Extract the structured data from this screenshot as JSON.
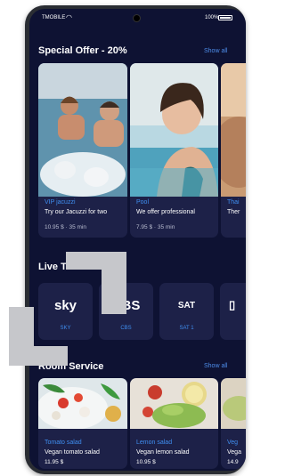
{
  "status": {
    "carrier": "TMOBILE",
    "battery": "100%"
  },
  "special_offer": {
    "title": "Special Offer - 20%",
    "show_all": "Show all",
    "cards": [
      {
        "title": "VIP jacuzzi",
        "desc": "Try our Jacuzzi for two",
        "meta": "10.95 $ · 35 min"
      },
      {
        "title": "Pool",
        "desc": "We offer professional",
        "meta": "7.95 $ · 35 min"
      },
      {
        "title": "Thai",
        "desc": "Ther"
      }
    ]
  },
  "live_tv": {
    "title": "Live T",
    "channels": [
      {
        "logo": "sky",
        "label": "SKY"
      },
      {
        "logo": "CBS",
        "label": "CBS"
      },
      {
        "logo": "SAT",
        "label": "SAT 1"
      }
    ]
  },
  "room_service": {
    "title": "Room Service",
    "show_all": "Show all",
    "cards": [
      {
        "title": "Tomato salad",
        "desc": "Vegan tomato salad",
        "meta": "11.95 $"
      },
      {
        "title": "Lemon salad",
        "desc": "Vegan lemon salad",
        "meta": "10.95 $"
      },
      {
        "title": "Veg",
        "desc": "Vega",
        "meta": "14.9"
      }
    ]
  },
  "colors": {
    "background": "#0e1233",
    "card": "#1d2148",
    "accent": "#3f8ef0"
  }
}
